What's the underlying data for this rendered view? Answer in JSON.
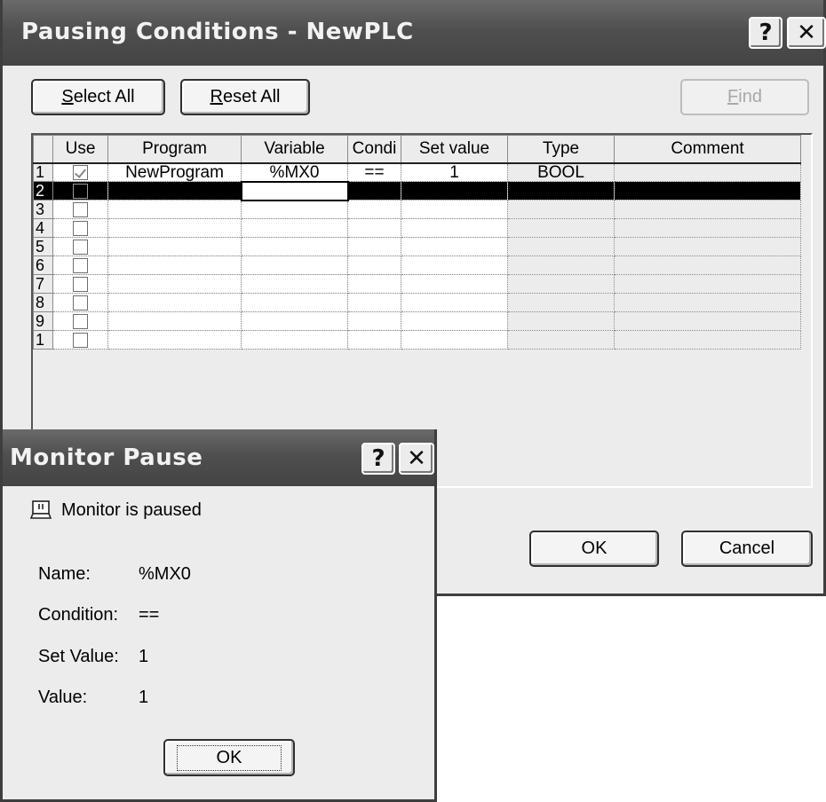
{
  "pausing_dialog": {
    "title": "Pausing Conditions - NewPLC",
    "help_label": "?",
    "close_label": "✕",
    "select_all": {
      "pre": "",
      "key": "S",
      "post": "elect All"
    },
    "reset_all": {
      "pre": "",
      "key": "R",
      "post": "eset All"
    },
    "find": {
      "pre": "",
      "key": "F",
      "post": "ind"
    },
    "columns": [
      "",
      "Use",
      "Program",
      "Variable",
      "Condi",
      "Set value",
      "Type",
      "Comment"
    ],
    "rows": [
      {
        "num": "1",
        "checked": true,
        "program": "NewProgram",
        "variable": "%MX0",
        "condition": "==",
        "set_value": "1",
        "type": "BOOL",
        "comment": ""
      },
      {
        "num": "2",
        "checked": false,
        "program": "",
        "variable": "",
        "condition": "",
        "set_value": "",
        "type": "",
        "comment": ""
      },
      {
        "num": "3",
        "checked": false,
        "program": "",
        "variable": "",
        "condition": "",
        "set_value": "",
        "type": "",
        "comment": ""
      },
      {
        "num": "4",
        "checked": false,
        "program": "",
        "variable": "",
        "condition": "",
        "set_value": "",
        "type": "",
        "comment": ""
      },
      {
        "num": "5",
        "checked": false,
        "program": "",
        "variable": "",
        "condition": "",
        "set_value": "",
        "type": "",
        "comment": ""
      },
      {
        "num": "6",
        "checked": false,
        "program": "",
        "variable": "",
        "condition": "",
        "set_value": "",
        "type": "",
        "comment": ""
      },
      {
        "num": "7",
        "checked": false,
        "program": "",
        "variable": "",
        "condition": "",
        "set_value": "",
        "type": "",
        "comment": ""
      },
      {
        "num": "8",
        "checked": false,
        "program": "",
        "variable": "",
        "condition": "",
        "set_value": "",
        "type": "",
        "comment": ""
      },
      {
        "num": "9",
        "checked": false,
        "program": "",
        "variable": "",
        "condition": "",
        "set_value": "",
        "type": "",
        "comment": ""
      },
      {
        "num": "1",
        "checked": false,
        "program": "",
        "variable": "",
        "condition": "",
        "set_value": "",
        "type": "",
        "comment": ""
      }
    ],
    "selected_row": 1,
    "ok_label": "OK",
    "cancel_label": "Cancel"
  },
  "pause_dialog": {
    "title": "Monitor Pause",
    "help_label": "?",
    "close_label": "✕",
    "status": "Monitor is paused",
    "fields": [
      {
        "label": "Name:",
        "value": "%MX0"
      },
      {
        "label": "Condition:",
        "value": "=="
      },
      {
        "label": "Set Value:",
        "value": "1"
      },
      {
        "label": "Value:",
        "value": "1"
      }
    ],
    "ok_label": "OK"
  }
}
